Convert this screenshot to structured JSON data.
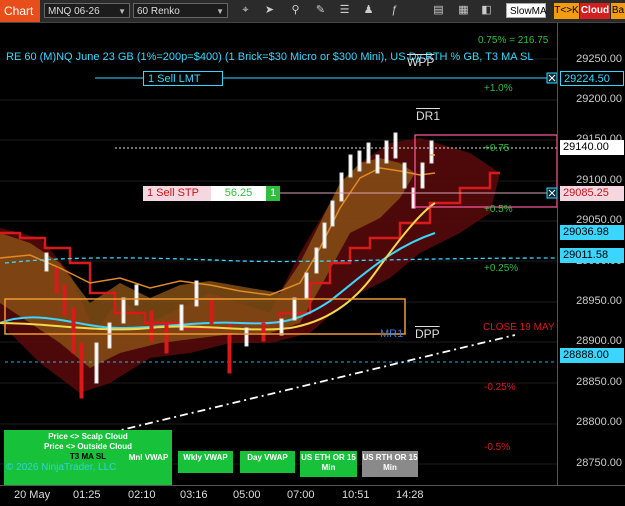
{
  "toolbar": {
    "chart_tab": "Chart",
    "instrument": "MNQ 06-26",
    "bar_type": "60 Renko",
    "indicator_select": "SlowMA",
    "btn_tck": "T<>K",
    "btn_cloud": "Cloud",
    "btn_ba": "Ba",
    "icons": [
      "crosshair-icon",
      "pointer-icon",
      "zoom-icon",
      "draw-icon",
      "properties-icon",
      "strategies-icon",
      "indicators-icon",
      "chart-trader-icon"
    ]
  },
  "title": "RE 60 (M)NQ June 23 GB (1%=200p=$400) (1 Brick=$30 Micro or $300 Mini), US Dy RTH % GB, T3 MA SL",
  "overlay_value": "0.75% = 216.75",
  "levels": {
    "wpp": "WPP",
    "dr1": "DR1",
    "mr1": "MR1",
    "dpp": "DPP",
    "close": "CLOSE 19 MAY",
    "pct": [
      "+1.0%",
      "+0.75",
      "+0.5%",
      "+0.25%",
      "-0.25%",
      "-0.5%"
    ]
  },
  "orders": {
    "sell_lmt": "1 Sell LMT",
    "sell_stp": "1 Sell STP",
    "stp_pnl": "56.25",
    "stp_qty": "1"
  },
  "price_axis": {
    "labels": [
      "29250.00",
      "29200.00",
      "29150.00",
      "29100.00",
      "29050.00",
      "29000.00",
      "28950.00",
      "28900.00",
      "28850.00",
      "28800.00",
      "28750.00"
    ],
    "boxes": {
      "sell_lmt": "29224.50",
      "last": "29140.00",
      "sell_stp": "29085.25",
      "ma1": "29036.98",
      "ma2": "29011.58",
      "vwap": "28888.00"
    }
  },
  "time_axis": [
    "20 May",
    "01:25",
    "02:10",
    "03:16",
    "05:00",
    "07:00",
    "10:51",
    "14:28"
  ],
  "buttons": {
    "price_scalp": "Price <> Scalp Cloud",
    "price_outside": "Price <> Outside Cloud",
    "t3": "T3 MA SL",
    "mnl_vwap": "Mnl VWAP",
    "wkly_vwap": "Wkly VWAP",
    "day_vwap": "Day VWAP",
    "us_eth": "US ETH OR 15 Min",
    "us_rth": "US RTH OR 15 Min"
  },
  "copyright": "© 2026 NinjaTrader, LLC",
  "colors": {
    "accent": "#e84e1b",
    "cyan": "#3ad6ff",
    "green": "#2fbf3f",
    "red": "#c81414"
  }
}
